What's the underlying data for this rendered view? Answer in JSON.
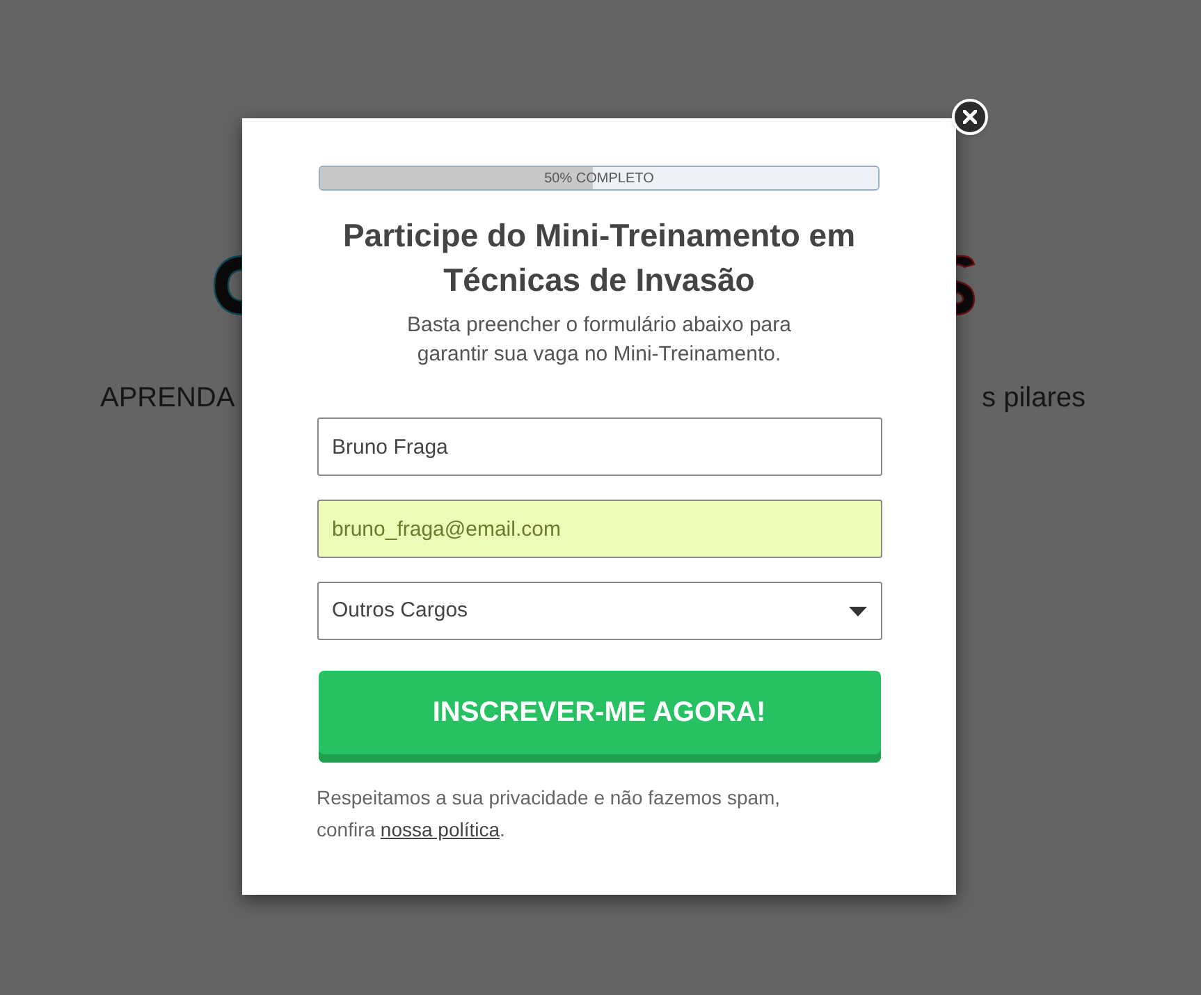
{
  "background_page": {
    "tagline_left": "APRENDA",
    "tagline_right": "s pilares"
  },
  "modal": {
    "progress": {
      "label": "50% COMPLETO",
      "level": 0.49
    },
    "title": "Participe do Mini-Treinamento em Técnicas de Invasão",
    "subtitle": "Basta preencher o formulário abaixo para garantir sua vaga no Mini-Treinamento.",
    "fields": [
      {
        "kind": "text",
        "value": "Bruno Fraga",
        "autofilled": false
      },
      {
        "kind": "text",
        "value": "bruno_fraga@email.com",
        "autofilled": true
      },
      {
        "kind": "select",
        "value": "Outros Cargos",
        "autofilled": false
      }
    ],
    "submit_button": "INSCREVER-ME AGORA!",
    "privacy_text": "Respeitamos a sua privacidade e não fazemos spam, confira ",
    "privacy_link": "nossa política",
    "privacy_end": "."
  }
}
